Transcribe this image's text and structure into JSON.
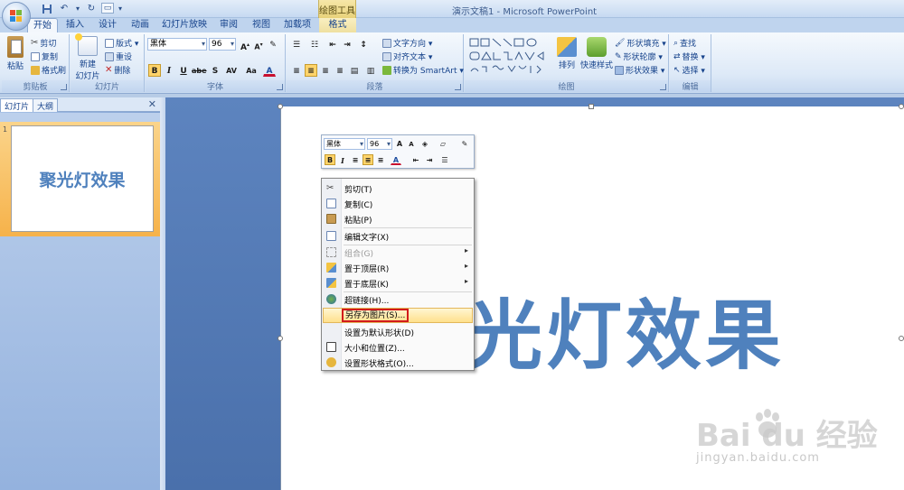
{
  "window": {
    "title": "演示文稿1 - Microsoft PowerPoint",
    "contextual_tab_group": "绘图工具"
  },
  "quick_access": {
    "icons": [
      "save-icon",
      "undo-icon",
      "redo-icon",
      "customize-icon"
    ]
  },
  "tabs": [
    {
      "label": "开始",
      "active": true
    },
    {
      "label": "插入"
    },
    {
      "label": "设计"
    },
    {
      "label": "动画"
    },
    {
      "label": "幻灯片放映"
    },
    {
      "label": "审阅"
    },
    {
      "label": "视图"
    },
    {
      "label": "加载项"
    },
    {
      "label": "格式",
      "contextual": true
    }
  ],
  "ribbon": {
    "clipboard": {
      "label": "剪贴板",
      "paste": "粘贴",
      "cut": "剪切",
      "copy": "复制",
      "format_painter": "格式刷"
    },
    "slides": {
      "label": "幻灯片",
      "new_slide_line1": "新建",
      "new_slide_line2": "幻灯片 ▾",
      "layout": "版式 ▾",
      "reset": "重设",
      "delete": "删除"
    },
    "font": {
      "label": "字体",
      "font_name": "黑体",
      "font_size": "96",
      "bold": "B",
      "italic": "I",
      "underline": "U",
      "strike": "abe",
      "shadow": "S",
      "spacing": "AV",
      "case": "Aa",
      "color": "A"
    },
    "paragraph": {
      "label": "段落",
      "text_direction": "文字方向 ▾",
      "align_text": "对齐文本 ▾",
      "smartart": "转换为 SmartArt ▾"
    },
    "drawing": {
      "label": "绘图",
      "arrange": "排列",
      "quick_styles": "快速样式",
      "shape_fill": "形状填充 ▾",
      "shape_outline": "形状轮廓 ▾",
      "shape_effects": "形状效果 ▾"
    },
    "editing": {
      "label": "编辑",
      "find": "查找",
      "replace": "替换 ▾",
      "select": "选择 ▾"
    }
  },
  "left_panel": {
    "tab_slides": "幻灯片",
    "tab_outline": "大纲",
    "close": "✕",
    "thumbnail_number": "1",
    "thumbnail_text": "聚光灯效果"
  },
  "slide": {
    "title_text": "聚光灯效果"
  },
  "mini_toolbar": {
    "font_name": "黑体",
    "font_size": "96",
    "bold": "B",
    "italic": "I",
    "color": "A"
  },
  "context_menu": {
    "items": [
      {
        "label": "剪切(T)",
        "icon": "cut-icon"
      },
      {
        "label": "复制(C)",
        "icon": "copy-icon"
      },
      {
        "label": "粘贴(P)",
        "icon": "paste-icon"
      },
      {
        "label": "编辑文字(X)",
        "icon": "edit-text-icon"
      },
      {
        "label": "组合(G)",
        "icon": "group-icon",
        "disabled": true,
        "submenu": true
      },
      {
        "label": "置于顶层(R)",
        "icon": "bring-front-icon",
        "submenu": true
      },
      {
        "label": "置于底层(K)",
        "icon": "send-back-icon",
        "submenu": true
      },
      {
        "label": "超链接(H)...",
        "icon": "hyperlink-icon"
      },
      {
        "label": "另存为图片(S)...",
        "icon": "",
        "highlighted": true
      },
      {
        "label": "设置为默认形状(D)",
        "icon": ""
      },
      {
        "label": "大小和位置(Z)...",
        "icon": "size-position-icon"
      },
      {
        "label": "设置形状格式(O)...",
        "icon": "format-shape-icon"
      }
    ]
  },
  "watermark": {
    "main": "Bai  du 经验",
    "sub": "jingyan.baidu.com"
  },
  "colors": {
    "accent_text": "#4f81bd",
    "highlight_border": "#d21b1b",
    "ribbon_text": "#15428b"
  }
}
